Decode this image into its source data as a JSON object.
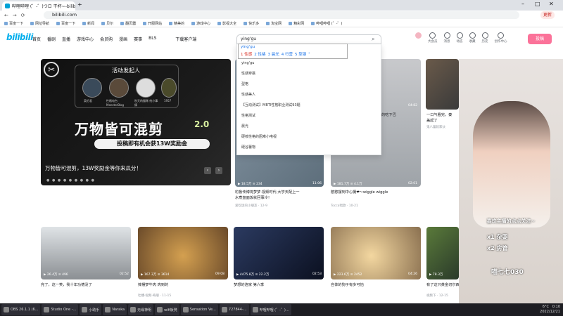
{
  "browser": {
    "tab_title": "哔哩哔哩 (゜-゜)つロ 干杯~-bilibili",
    "url": "bilibili.com",
    "bookmarks": [
      "百度一下",
      "网址导航",
      "百度一下",
      "新闻",
      "贝尔",
      "翻页器",
      "开服网站",
      "精美的",
      "游戏中心",
      "影视大全",
      "快乐多",
      "淘宝网",
      "精彩网",
      "哔哩哔哩 (゜-゜)"
    ],
    "update_button": "更新"
  },
  "site": {
    "logo": "bilibili",
    "nav": [
      "首页",
      "番剧",
      "直播",
      "游戏中心",
      "会员购",
      "漫画",
      "赛事",
      "BLS",
      "下载客户端"
    ],
    "search_value": "ying'gu",
    "right_icons": [
      "大会员",
      "消息",
      "动态",
      "收藏",
      "历史",
      "创作中心"
    ],
    "upload": "投稿"
  },
  "ime": {
    "pinyin": "ying'gu",
    "candidates": [
      "1 性感",
      "2 性格",
      "3 晨光",
      "4 行营",
      "5 型钢"
    ]
  },
  "dropdown": {
    "items": [
      "yinggu",
      "ying'gu",
      "性感穿搭",
      "型格",
      "性感美人",
      "【互动测试】MBTI性格职业测试93题",
      "性格测试",
      "晨光",
      "硬核性格的困难小电视",
      "硬谷薯物"
    ]
  },
  "banner": {
    "activity_title": "活动发起人",
    "hosts": [
      "英伦君",
      "性格电台 MonsterBlog",
      "秋天的猫咪 给小事情",
      "1957"
    ],
    "title": "万物皆可混剪",
    "version": "2.0",
    "sub": "投稿即有机会获13W奖励金",
    "caption": "万物皆可混剪，13W奖励金等你来瓜分！"
  },
  "cards_row1": [
    {
      "title": "豹鲁传博将梦梦·视频时代·大学天配上一",
      "title2": "水煮盘面饭就回事冷！",
      "author": "爱吃饭的小朋友 · 12-9",
      "views": "18.5万",
      "danmaku": "234",
      "dur": "11:06"
    },
    {
      "title": "憨憨摆到中心摄❤～wiggle wiggle",
      "author": "Tocca唱歌 · 10-21",
      "views": "181.7万",
      "danmaku": "4.1万",
      "dur": "02:01"
    }
  ],
  "cards_row1_right": [
    {
      "title": "的吃下巴",
      "views": "",
      "dur": "04:82"
    },
    {
      "title": "一口气看完，秦",
      "title2": "盖起了",
      "author": "鬼八蕾就家伙"
    }
  ],
  "cards_row2": [
    {
      "title": "完了，这一笑，我十年功德没了",
      "author": "",
      "views": "26.4万",
      "danmaku": "496",
      "dur": "02:52"
    },
    {
      "title": "摔摆梦牛肉 肉到的",
      "author": "吐槽·视频·奇朋 · 11-15",
      "views": "167.3万",
      "danmaku": "3614",
      "dur": "09:08"
    },
    {
      "title": "梦想的连家 第六季",
      "author": "",
      "views": "4475.8万",
      "danmaku": "22.2万",
      "dur": "02:53"
    },
    {
      "title": "自体的狗子有多可怕",
      "author": "",
      "views": "223.6万",
      "danmaku": "2452",
      "dur": "04:26"
    },
    {
      "title": "有了这只黄金切尔西，康那和素食同志的",
      "author": "视频下 · 12-15",
      "views": "78.3万",
      "danmaku": "",
      "dur": "06:28"
    }
  ],
  "stream_overlay": {
    "headline": "喜欢主播的点点关注~",
    "gift1": "x1 杂耍",
    "gift2": "x2 房管",
    "brand": "喵七七030"
  },
  "taskbar": {
    "items": [
      "OBS 26.1.1 (6...",
      "Studio One -...",
      "小助手",
      "Naraka",
      "无缘神明",
      "wifi板凳",
      "Sensation Ve...",
      "727844-...",
      "哔哩哔哩 (゜-゜)..."
    ],
    "temp": "6°C",
    "time": "0:10",
    "date": "2022/12/21"
  }
}
